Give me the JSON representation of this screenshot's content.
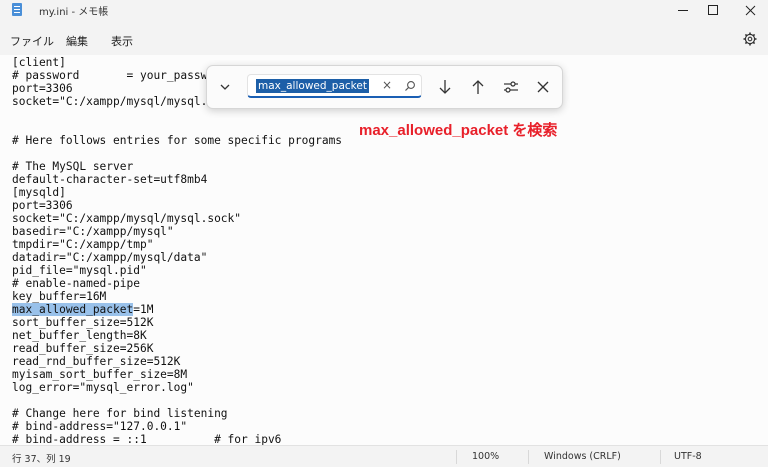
{
  "window": {
    "title": "my.ini - メモ帳"
  },
  "menu": {
    "file": "ファイル",
    "edit": "編集",
    "view": "表示"
  },
  "editor": {
    "lines": [
      "[client]",
      "# password       = your_password",
      "port=3306",
      "socket=\"C:/xampp/mysql/mysql.sock\"",
      "",
      "# Here follows entries for some specific programs",
      "",
      "# The MySQL server",
      "default-character-set=utf8mb4",
      "[mysqld]",
      "port=3306",
      "socket=\"C:/xampp/mysql/mysql.sock\"",
      "basedir=\"C:/xampp/mysql\"",
      "tmpdir=\"C:/xampp/tmp\"",
      "datadir=\"C:/xampp/mysql/data\"",
      "pid_file=\"mysql.pid\"",
      "# enable-named-pipe",
      "key_buffer=16M",
      "=1M",
      "sort_buffer_size=512K",
      "net_buffer_length=8K",
      "read_buffer_size=256K",
      "read_rnd_buffer_size=512K",
      "myisam_sort_buffer_size=8M",
      "log_error=\"mysql_error.log\"",
      "",
      "# Change here for bind listening",
      "# bind-address=\"127.0.0.1\"",
      "# bind-address = ::1          # for ipv6"
    ],
    "highlight": "max_allowed_packet"
  },
  "find": {
    "value": "max_allowed_packet",
    "clear_glyph": "×"
  },
  "annotation": {
    "text": "max_allowed_packet を検索",
    "color": "#e8202a"
  },
  "status": {
    "position": "行 37、列 19",
    "zoom": "100%",
    "line_ending": "Windows (CRLF)",
    "encoding": "UTF-8"
  },
  "icons": {
    "app": "notepad-icon",
    "settings": "gear-icon",
    "find_toggle": "chevron-down-icon",
    "find_next": "arrow-down-icon",
    "find_prev": "arrow-up-icon",
    "find_options": "sliders-icon",
    "find_close": "close-icon",
    "search": "search-icon"
  }
}
